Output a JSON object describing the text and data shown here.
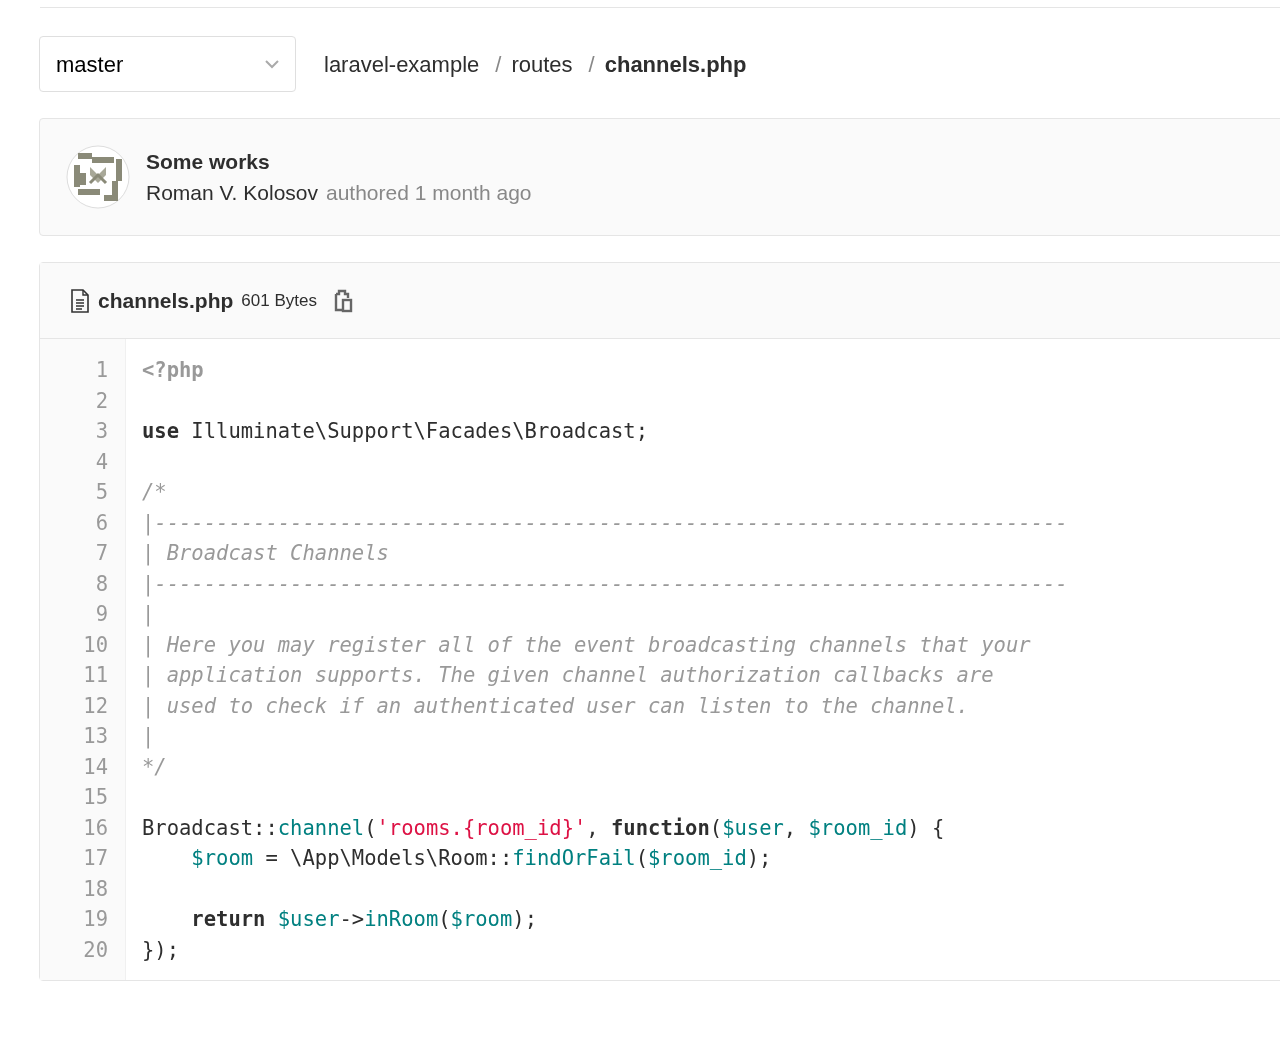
{
  "branch_select": {
    "value": "master"
  },
  "breadcrumb": [
    {
      "label": "laravel-example",
      "current": false
    },
    {
      "label": "routes",
      "current": false
    },
    {
      "label": "channels.php",
      "current": true
    }
  ],
  "breadcrumb_separator": "/",
  "commit": {
    "title": "Some works",
    "author": "Roman V. Kolosov",
    "meta": "authored 1 month ago"
  },
  "file": {
    "name": "channels.php",
    "size": "601 Bytes",
    "lines": [
      {
        "number": "1",
        "tokens": [
          {
            "kind": "meta",
            "text": "<?php"
          }
        ]
      },
      {
        "number": "2"
      },
      {
        "number": "3",
        "tokens": [
          {
            "kind": "keyword",
            "text": "use"
          },
          {
            "kind": "plain",
            "text": " Illuminate\\Support\\Facades\\Broadcast;"
          }
        ]
      },
      {
        "number": "4"
      },
      {
        "number": "5",
        "tokens": [
          {
            "kind": "comment",
            "text": "/*"
          }
        ]
      },
      {
        "number": "6",
        "tokens": [
          {
            "kind": "comment",
            "text": "|--------------------------------------------------------------------------"
          }
        ]
      },
      {
        "number": "7",
        "tokens": [
          {
            "kind": "comment",
            "text": "| Broadcast Channels"
          }
        ]
      },
      {
        "number": "8",
        "tokens": [
          {
            "kind": "comment",
            "text": "|--------------------------------------------------------------------------"
          }
        ]
      },
      {
        "number": "9",
        "tokens": [
          {
            "kind": "comment",
            "text": "|"
          }
        ]
      },
      {
        "number": "10",
        "tokens": [
          {
            "kind": "comment",
            "text": "| Here you may register all of the event broadcasting channels that your"
          }
        ]
      },
      {
        "number": "11",
        "tokens": [
          {
            "kind": "comment",
            "text": "| application supports. The given channel authorization callbacks are"
          }
        ]
      },
      {
        "number": "12",
        "tokens": [
          {
            "kind": "comment",
            "text": "| used to check if an authenticated user can listen to the channel."
          }
        ]
      },
      {
        "number": "13",
        "tokens": [
          {
            "kind": "comment",
            "text": "|"
          }
        ]
      },
      {
        "number": "14",
        "tokens": [
          {
            "kind": "comment",
            "text": "*/"
          }
        ]
      },
      {
        "number": "15"
      },
      {
        "number": "16",
        "tokens": [
          {
            "kind": "plain",
            "text": "Broadcast::"
          },
          {
            "kind": "func",
            "text": "channel"
          },
          {
            "kind": "plain",
            "text": "("
          },
          {
            "kind": "string",
            "text": "'rooms.{room_id}'"
          },
          {
            "kind": "plain",
            "text": ", "
          },
          {
            "kind": "keyword",
            "text": "function"
          },
          {
            "kind": "plain",
            "text": "("
          },
          {
            "kind": "var",
            "text": "$user"
          },
          {
            "kind": "plain",
            "text": ", "
          },
          {
            "kind": "var",
            "text": "$room_id"
          },
          {
            "kind": "plain",
            "text": ") {"
          }
        ]
      },
      {
        "number": "17",
        "indented": true,
        "tokens": [
          {
            "kind": "var",
            "text": "$room"
          },
          {
            "kind": "plain",
            "text": " = \\App\\Models\\Room::"
          },
          {
            "kind": "func",
            "text": "findOrFail"
          },
          {
            "kind": "plain",
            "text": "("
          },
          {
            "kind": "var",
            "text": "$room_id"
          },
          {
            "kind": "plain",
            "text": ");"
          }
        ]
      },
      {
        "number": "18"
      },
      {
        "number": "19",
        "indented": true,
        "tokens": [
          {
            "kind": "keyword",
            "text": "return"
          },
          {
            "kind": "var",
            "text": " $user"
          },
          {
            "kind": "plain",
            "text": "->"
          },
          {
            "kind": "func",
            "text": "inRoom"
          },
          {
            "kind": "plain",
            "text": "("
          },
          {
            "kind": "var",
            "text": "$room"
          },
          {
            "kind": "plain",
            "text": ");"
          }
        ]
      },
      {
        "number": "20",
        "tokens": [
          {
            "kind": "plain",
            "text": "});"
          }
        ]
      }
    ]
  }
}
